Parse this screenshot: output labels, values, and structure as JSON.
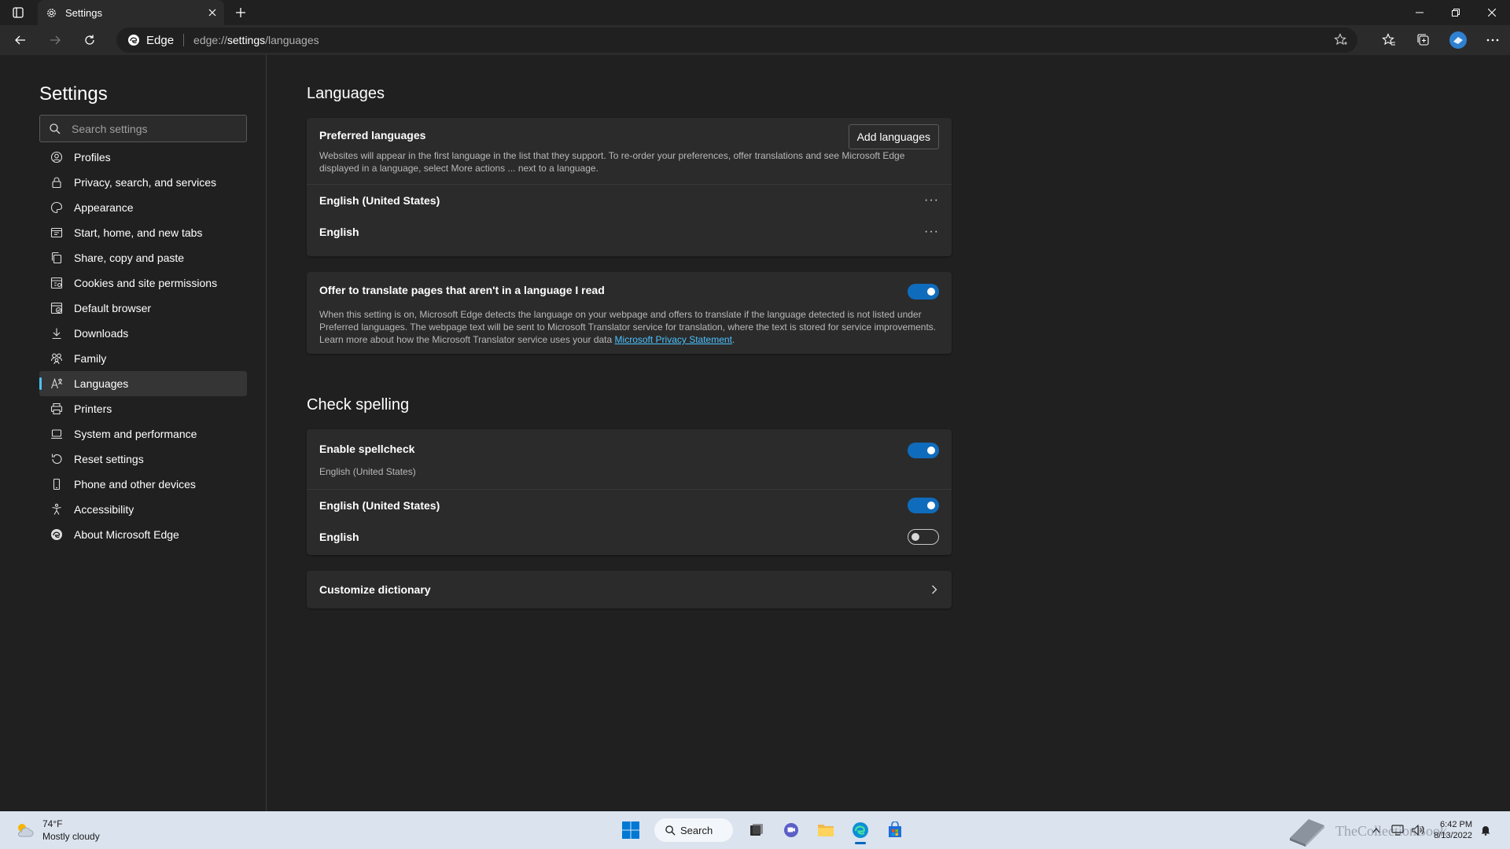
{
  "window": {
    "tab_title": "Settings"
  },
  "toolbar": {
    "site_label": "Edge",
    "url_prefix": "edge://",
    "url_bold": "settings",
    "url_suffix": "/languages"
  },
  "sidebar": {
    "title": "Settings",
    "search_placeholder": "Search settings",
    "items": [
      {
        "label": "Profiles",
        "icon": "profile-icon"
      },
      {
        "label": "Privacy, search, and services",
        "icon": "lock-icon"
      },
      {
        "label": "Appearance",
        "icon": "appearance-icon"
      },
      {
        "label": "Start, home, and new tabs",
        "icon": "home-tabs-icon"
      },
      {
        "label": "Share, copy and paste",
        "icon": "share-icon"
      },
      {
        "label": "Cookies and site permissions",
        "icon": "cookies-icon"
      },
      {
        "label": "Default browser",
        "icon": "default-browser-icon"
      },
      {
        "label": "Downloads",
        "icon": "download-icon"
      },
      {
        "label": "Family",
        "icon": "family-icon"
      },
      {
        "label": "Languages",
        "icon": "languages-icon",
        "active": true
      },
      {
        "label": "Printers",
        "icon": "printer-icon"
      },
      {
        "label": "System and performance",
        "icon": "laptop-icon"
      },
      {
        "label": "Reset settings",
        "icon": "reset-icon"
      },
      {
        "label": "Phone and other devices",
        "icon": "phone-icon"
      },
      {
        "label": "Accessibility",
        "icon": "accessibility-icon"
      },
      {
        "label": "About Microsoft Edge",
        "icon": "edge-icon"
      }
    ]
  },
  "languages": {
    "heading": "Languages",
    "preferred": {
      "title": "Preferred languages",
      "add_button": "Add languages",
      "description": "Websites will appear in the first language in the list that they support. To re-order your preferences, offer translations and see Microsoft Edge displayed in a language, select More actions ... next to a language.",
      "items": [
        "English (United States)",
        "English"
      ]
    },
    "translate": {
      "title": "Offer to translate pages that aren't in a language I read",
      "enabled": true,
      "description": "When this setting is on, Microsoft Edge detects the language on your webpage and offers to translate if the language detected is not listed under Preferred languages. The webpage text will be sent to Microsoft Translator service for translation, where the text is stored for service improvements. Learn more about how the Microsoft Translator service uses your data",
      "link": "Microsoft Privacy Statement"
    }
  },
  "spelling": {
    "heading": "Check spelling",
    "enable_title": "Enable spellcheck",
    "enable_sub": "English (United States)",
    "enable_on": true,
    "langs": [
      {
        "label": "English (United States)",
        "on": true
      },
      {
        "label": "English",
        "on": false
      }
    ],
    "customize": "Customize dictionary"
  },
  "taskbar": {
    "temp": "74°F",
    "condition": "Mostly cloudy",
    "search_label": "Search",
    "time": "6:42 PM",
    "date": "8/13/2022",
    "watermark": "TheCollectionBook"
  },
  "colors": {
    "accent": "#0f6cbd",
    "link": "#4cc2ff",
    "background": "#202020",
    "card": "#2b2b2b"
  }
}
